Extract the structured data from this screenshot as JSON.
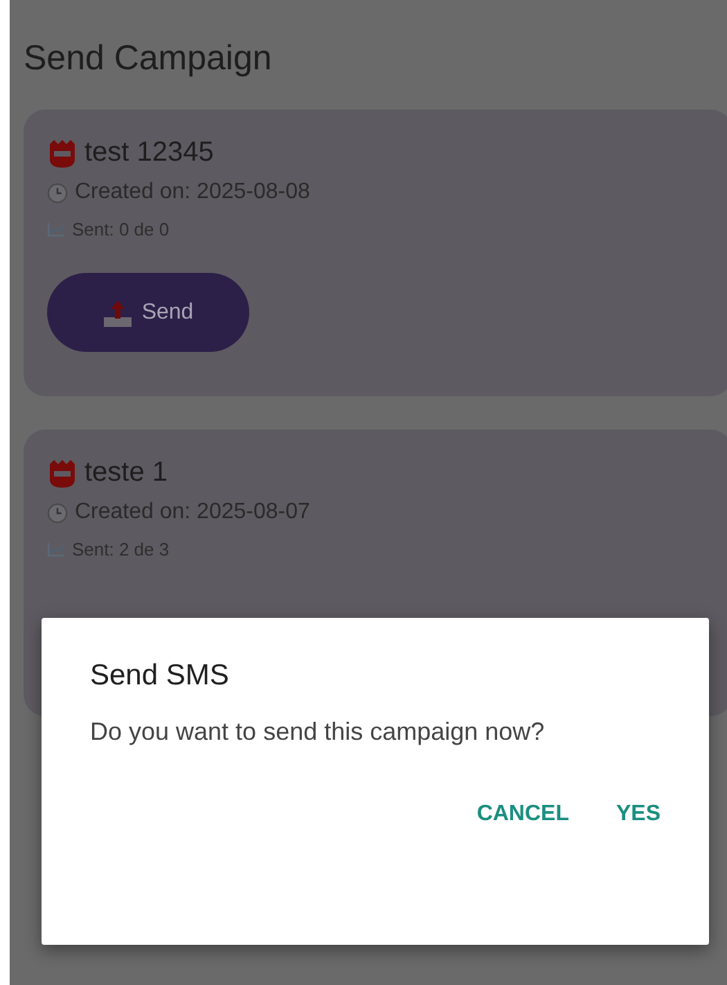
{
  "screen": {
    "title": "Send Campaign"
  },
  "campaigns": [
    {
      "name": "test 12345",
      "created": "Created on: 2025-08-08",
      "sent": "Sent: 0 de 0",
      "button": "Send"
    },
    {
      "name": "teste 1",
      "created": "Created on: 2025-08-07",
      "sent": "Sent: 2 de 3"
    }
  ],
  "dialog": {
    "title": "Send SMS",
    "message": "Do you want to send this campaign now?",
    "buttons": [
      "CANCEL",
      "YES"
    ]
  }
}
